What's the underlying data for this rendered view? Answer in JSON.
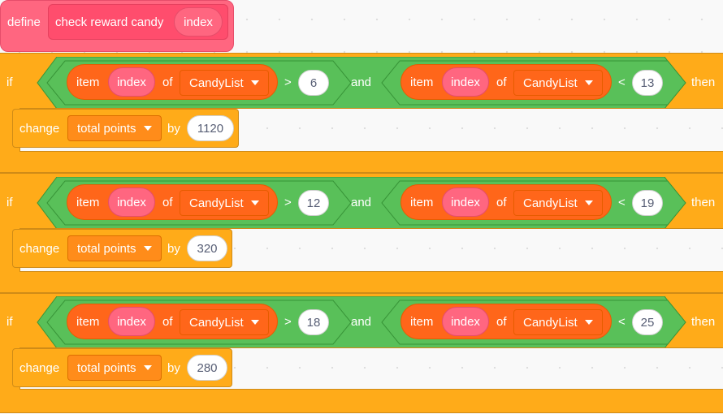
{
  "define_block": {
    "label": "define",
    "custom_block_name": "check reward candy",
    "argument": "index"
  },
  "if_blocks": [
    {
      "if_label": "if",
      "then_label": "then",
      "and_label": "and",
      "left": {
        "item_label": "item",
        "index_arg": "index",
        "of_label": "of",
        "list_name": "CandyList",
        "operator": ">",
        "value": "6"
      },
      "right": {
        "item_label": "item",
        "index_arg": "index",
        "of_label": "of",
        "list_name": "CandyList",
        "operator": "<",
        "value": "13"
      },
      "change": {
        "label": "change",
        "variable": "total points",
        "by_label": "by",
        "amount": "1120"
      }
    },
    {
      "if_label": "if",
      "then_label": "then",
      "and_label": "and",
      "left": {
        "item_label": "item",
        "index_arg": "index",
        "of_label": "of",
        "list_name": "CandyList",
        "operator": ">",
        "value": "12"
      },
      "right": {
        "item_label": "item",
        "index_arg": "index",
        "of_label": "of",
        "list_name": "CandyList",
        "operator": "<",
        "value": "19"
      },
      "change": {
        "label": "change",
        "variable": "total points",
        "by_label": "by",
        "amount": "320"
      }
    },
    {
      "if_label": "if",
      "then_label": "then",
      "and_label": "and",
      "left": {
        "item_label": "item",
        "index_arg": "index",
        "of_label": "of",
        "list_name": "CandyList",
        "operator": ">",
        "value": "18"
      },
      "right": {
        "item_label": "item",
        "index_arg": "index",
        "of_label": "of",
        "list_name": "CandyList",
        "operator": "<",
        "value": "25"
      },
      "change": {
        "label": "change",
        "variable": "total points",
        "by_label": "by",
        "amount": "280"
      }
    }
  ],
  "colors": {
    "control": "#ffab19",
    "operators": "#59c059",
    "list": "#ff661a",
    "variables": "#ff8c1a",
    "custom_block": "#ff6680"
  }
}
